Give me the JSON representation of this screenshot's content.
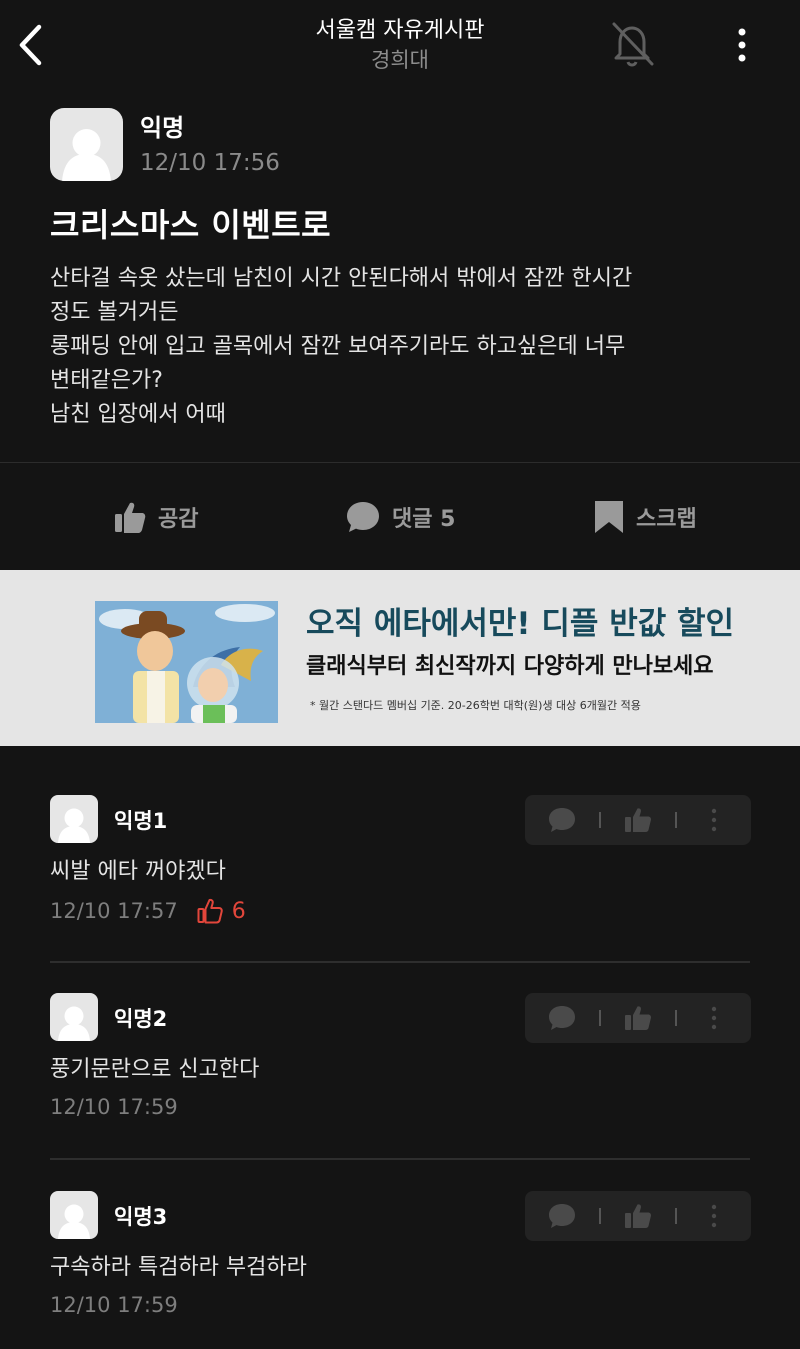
{
  "header": {
    "title": "서울캠 자유게시판",
    "subtitle": "경희대"
  },
  "post": {
    "author": "익명",
    "time": "12/10 17:56",
    "title": "크리스마스 이벤트로",
    "body": "산타걸 속옷 샀는데 남친이 시간 안된다해서 밖에서 잠깐 한시간\n정도 볼거거든\n롱패딩 안에 입고 골목에서 잠깐 보여주기라도 하고싶은데 너무\n변태같은가?\n남친 입장에서 어때"
  },
  "actions": {
    "like_label": "공감",
    "comment_label": "댓글 5",
    "scrap_label": "스크랩"
  },
  "ad": {
    "headline": "오직 에타에서만! 디플 반값 할인",
    "subline": "클래식부터 최신작까지 다양하게 만나보세요",
    "fineprint": "* 월간 스탠다드 멤버십 기준. 20-26학번 대학(원)생 대상 6개월간 적용"
  },
  "comments": [
    {
      "author": "익명1",
      "body": "씨발 에타 꺼야겠다",
      "time": "12/10 17:57",
      "likes": "6"
    },
    {
      "author": "익명2",
      "body": "풍기문란으로 신고한다",
      "time": "12/10 17:59"
    },
    {
      "author": "익명3",
      "body": "구속하라 특검하라 부검하라",
      "time": "12/10 17:59"
    }
  ],
  "colors": {
    "background": "#141414",
    "secondary_text": "#8a8a8a",
    "like_red": "#e2463b",
    "ad_headline": "#174a5c",
    "ad_background": "#e5e5e5"
  },
  "icons": [
    "back-arrow-icon",
    "bell-off-icon",
    "more-vertical-icon",
    "thumbs-up-icon",
    "speech-bubble-icon",
    "bookmark-icon"
  ]
}
